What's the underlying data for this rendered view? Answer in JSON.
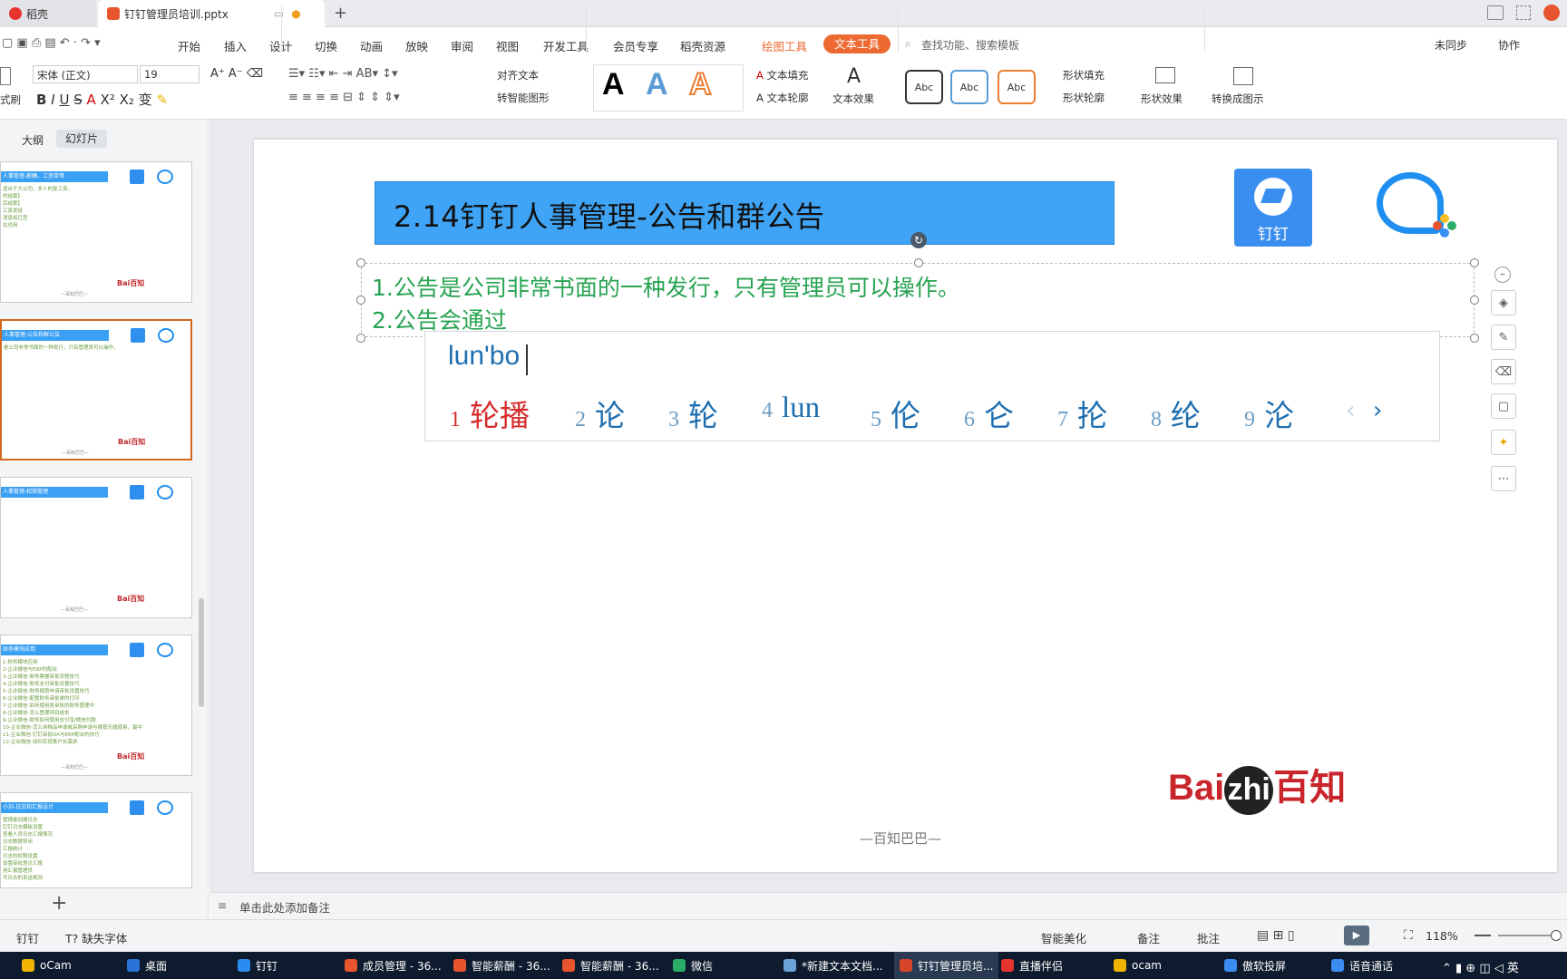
{
  "tabs": [
    {
      "label": "稻壳"
    },
    {
      "label": "钉钉管理员培训.pptx"
    }
  ],
  "menu": [
    "开始",
    "插入",
    "设计",
    "切换",
    "动画",
    "放映",
    "审阅",
    "视图",
    "开发工具",
    "会员专享",
    "稻壳资源",
    "绘图工具",
    "文本工具"
  ],
  "search_placeholder": "查找功能、搜索模板",
  "top_right": {
    "sync": "未同步",
    "collab": "协作"
  },
  "ribbon": {
    "format_brush": "式刷",
    "font_name": "宋体 (正文)",
    "font_size": "19",
    "align_text": "对齐文本",
    "smart_shape": "转智能图形",
    "text_fill": "文本填充",
    "text_outline": "文本轮廓",
    "text_effect": "文本效果",
    "abc": "Abc",
    "shape_fill": "形状填充",
    "shape_outline": "形状轮廓",
    "shape_effect": "形状效果",
    "convert": "转换成图示"
  },
  "left_tabs": {
    "outline": "大纲",
    "slides": "幻灯片"
  },
  "thumbnails": [
    {
      "header": "人事管理-薪酬、工资单等",
      "lines": [
        "适合于大公司，多人的复工资。",
        "的结算】",
        "后结算】",
        "工资发给",
        "消息如已签",
        "在也用"
      ]
    },
    {
      "header": "人事管理-公告和群公告",
      "lines": [
        "是公司非常书面的一种发行，只有管理员可以操作。"
      ]
    },
    {
      "header": "人事管理-权限管理",
      "lines": []
    },
    {
      "header": "财务模块应用",
      "lines": [
        "1-财务模块应用",
        "2-企业微信与ERP的配合",
        "3-企业微信-财务票据审批流程技巧",
        "4-企业微信-财务支付审批设置技巧",
        "5-企业微信-财务报销申请审批设置技巧",
        "6-企业微信-配置财务审批单的打印",
        "7-企业微信-如何使用各审批的财务管理中",
        "8-企业微信-怎么管理项目成本",
        "9-企业微信-财务如何使用支付宝/微信付款",
        "10-企业微信-怎么用物品申请或采购申请与报销无缝使用，最中",
        "11-企业微信-钉钉审批OA与ERP配合的技巧",
        "12-企业微信-如何实现客户化需求"
      ]
    },
    {
      "header": "小刘-日志和汇报设计",
      "lines": [
        "管理者创建日志",
        "钉钉日志模板设置",
        "查看人员日志汇报情况",
        "日志数据导出",
        "汇报统计",
        "日志的权限设置",
        "设置审批意见汇报",
        "用汇报管理员",
        "写日志的发送规则",
        "日报周报月报",
        "日志数据统计",
        "日志格式设置",
        "日志消息提醒",
        "日志汇报人员设置",
        "日志提醒设置"
      ]
    }
  ],
  "slide": {
    "title": "2.14钉钉人事管理-公告和群公告",
    "line1": "1.公告是公司非常书面的一种发行，只有管理员可以操作。",
    "line2": "2.公告会通过",
    "dingtalk_label": "钉钉",
    "baizhi_logo_a": "Bai",
    "baizhi_logo_b": "zhi",
    "baizhi_logo_c": "百知",
    "footer": "—百知巴巴—"
  },
  "ime": {
    "input": "lun'bo",
    "candidates": [
      {
        "n": "1",
        "t": "轮播"
      },
      {
        "n": "2",
        "t": "论"
      },
      {
        "n": "3",
        "t": "轮"
      },
      {
        "n": "4",
        "t": "lun"
      },
      {
        "n": "5",
        "t": "伦"
      },
      {
        "n": "6",
        "t": "仑"
      },
      {
        "n": "7",
        "t": "抡"
      },
      {
        "n": "8",
        "t": "纶"
      },
      {
        "n": "9",
        "t": "沦"
      }
    ]
  },
  "notes_placeholder": "单击此处添加备注",
  "status": {
    "left_item": "钉钉",
    "missing_fonts": "缺失字体",
    "beautify": "智能美化",
    "notes": "备注",
    "comment": "批注",
    "zoom": "118%"
  },
  "taskbar": [
    {
      "label": "oCam",
      "color": "#f0b400"
    },
    {
      "label": "桌面",
      "color": "#2a74d8"
    },
    {
      "label": "钉钉",
      "color": "#2a8cf0"
    },
    {
      "label": "成员管理 - 36...",
      "color": "#e8542e"
    },
    {
      "label": "智能薪酬 - 36...",
      "color": "#e8542e"
    },
    {
      "label": "智能薪酬 - 36...",
      "color": "#e8542e"
    },
    {
      "label": "微信",
      "color": "#2aae67"
    },
    {
      "label": "*新建文本文档...",
      "color": "#6aa2d8"
    },
    {
      "label": "钉钉管理员培...",
      "color": "#d8452a"
    },
    {
      "label": "直播伴侣",
      "color": "#e8342e"
    },
    {
      "label": "ocam",
      "color": "#f0b400"
    },
    {
      "label": "傲软投屏",
      "color": "#3a8cf0"
    },
    {
      "label": "语音通话",
      "color": "#3a8cf0"
    }
  ],
  "colors": {
    "accent_orange": "#ec6a32",
    "title_blue": "#3fa4f5",
    "body_green": "#28a352"
  }
}
